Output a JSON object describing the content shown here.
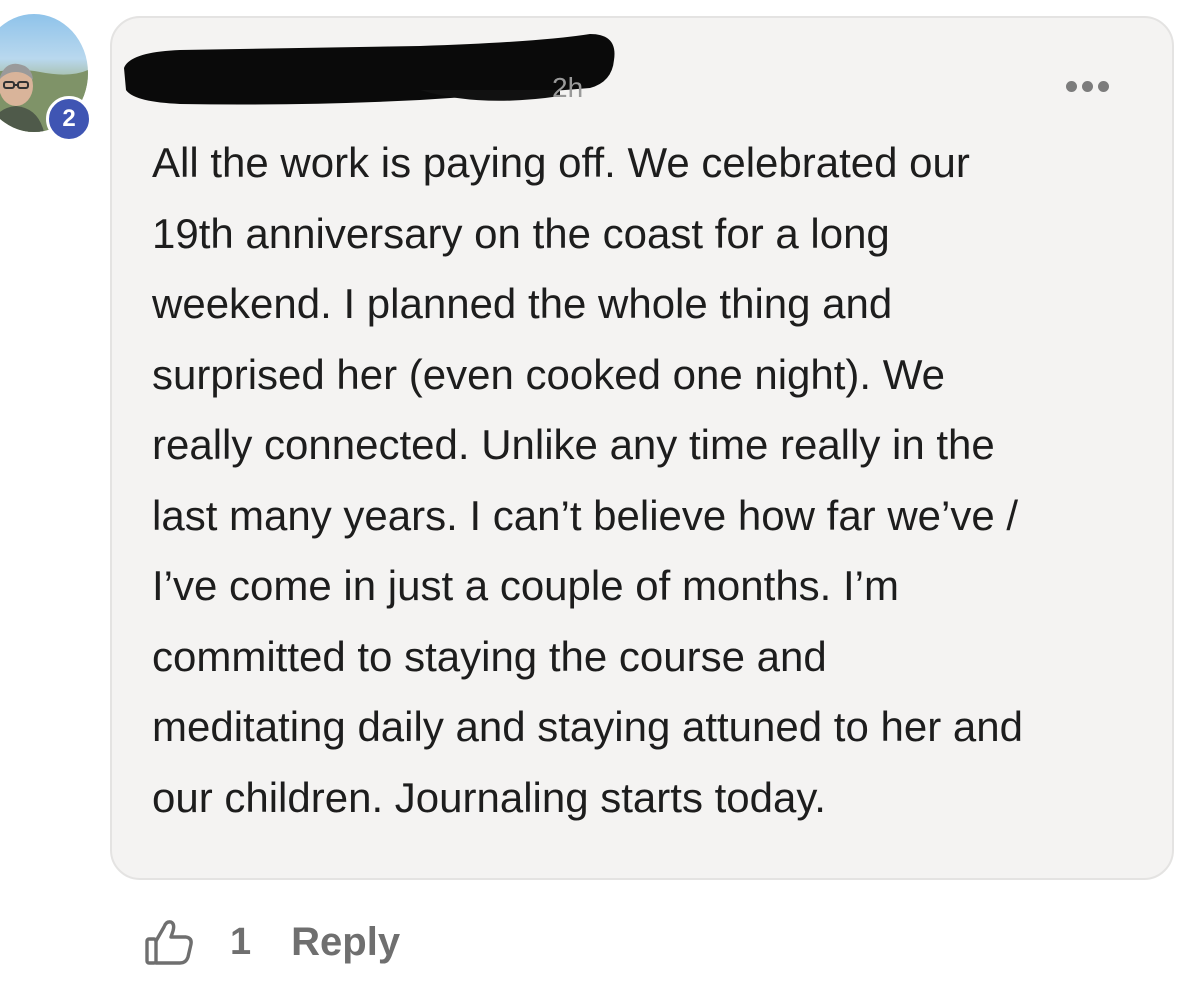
{
  "comment": {
    "author": {
      "name": "",
      "level_badge": "2"
    },
    "timestamp": "2h",
    "more_icon": "more-horizontal-icon",
    "body": "All the work is paying off. We celebrated our\n19th anniversary on the coast for a long\nweekend. I planned the whole thing and\nsurprised her (even cooked one night). We\nreally connected. Unlike any time really in the\nlast many years. I can’t believe how far we’ve /\nI’ve come in just a couple of months. I’m\ncommitted to staying the course and\nmeditating daily and staying attuned to her and\nour children. Journaling starts today.",
    "reactions": {
      "like_icon": "thumbs-up-icon",
      "like_count": "1"
    },
    "reply_label": "Reply"
  },
  "colors": {
    "bubble_background": "#f4f3f2",
    "badge": "#3f55b3",
    "muted_text": "#6f6f6f"
  }
}
